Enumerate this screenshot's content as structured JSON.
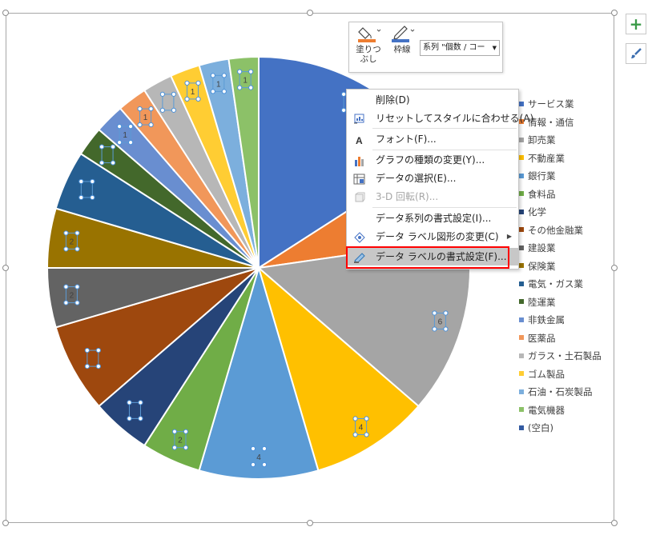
{
  "chart_data": {
    "type": "pie",
    "categories": [
      "サービス業",
      "情報・通信",
      "卸売業",
      "不動産業",
      "銀行業",
      "食料品",
      "化学",
      "その他金融業",
      "建設業",
      "保険業",
      "電気・ガス業",
      "陸運業",
      "非鉄金属",
      "医薬品",
      "ガラス・土石製品",
      "ゴム製品",
      "石油・石炭製品",
      "電気機器",
      "(空白)"
    ],
    "values": [
      7,
      3,
      6,
      4,
      4,
      2,
      2,
      3,
      2,
      2,
      2,
      1,
      1,
      1,
      1,
      1,
      1,
      1,
      0
    ],
    "colors": [
      "#4472c4",
      "#ed7d31",
      "#a5a5a5",
      "#ffc000",
      "#5b9bd5",
      "#70ad47",
      "#264478",
      "#9e480e",
      "#636363",
      "#997300",
      "#255e91",
      "#43682b",
      "#698ed0",
      "#f1975a",
      "#b7b7b7",
      "#ffcd33",
      "#7cafdd",
      "#8cc168",
      "#335aa1"
    ],
    "data_labels": [
      "7",
      "",
      "6",
      "4",
      "4",
      "2",
      "",
      "",
      "2",
      "2",
      "",
      "",
      "1",
      "1",
      "",
      "1",
      "1",
      "1",
      ""
    ],
    "legend_position": "right"
  },
  "toolbar": {
    "fill_label_1": "塗りつ",
    "fill_label_2": "ぶし",
    "outline_label": "枠線",
    "series_select": "系列 \"個数 / コー"
  },
  "menu": {
    "items": [
      {
        "label": "削除(D)",
        "icon": "",
        "disabled": false
      },
      {
        "label": "リセットしてスタイルに合わせる(A)",
        "icon": "reset-style-icon",
        "disabled": false
      },
      {
        "label": "フォント(F)...",
        "icon": "font-icon",
        "disabled": false
      },
      {
        "label": "グラフの種類の変更(Y)...",
        "icon": "chart-type-icon",
        "disabled": false
      },
      {
        "label": "データの選択(E)...",
        "icon": "select-data-icon",
        "disabled": false
      },
      {
        "label": "3-D 回転(R)...",
        "icon": "rotate-3d-icon",
        "disabled": true
      },
      {
        "label": "データ系列の書式設定(I)...",
        "icon": "",
        "disabled": false
      },
      {
        "label": "データ ラベル図形の変更(C)",
        "icon": "label-shape-icon",
        "disabled": false
      },
      {
        "label": "データ ラベルの書式設定(F)...",
        "icon": "format-label-icon",
        "disabled": false
      }
    ]
  }
}
